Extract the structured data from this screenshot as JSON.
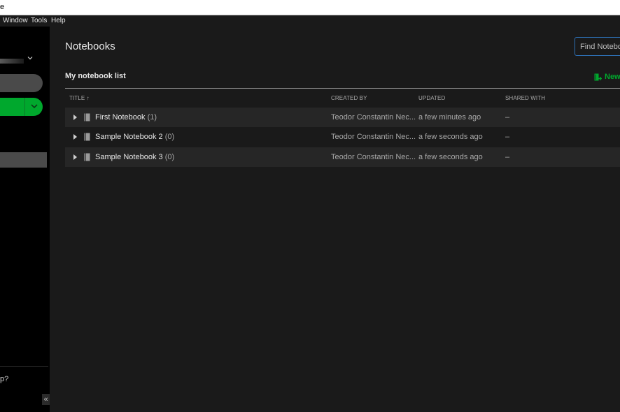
{
  "window": {
    "title_fragment": "e"
  },
  "menu": {
    "items": [
      "Window",
      "Tools",
      "Help"
    ]
  },
  "sidebar": {
    "help_text_fragment": "p?",
    "collapse_glyph": "«"
  },
  "main": {
    "page_title": "Notebooks",
    "search_placeholder": "Find Notebooks",
    "list_title": "My notebook list",
    "new_notebook_label": "New",
    "columns": {
      "title": "TITLE",
      "title_sort_arrow": "↑",
      "created_by": "CREATED BY",
      "updated": "UPDATED",
      "shared_with": "SHARED WITH"
    },
    "notebooks": [
      {
        "name": "First Notebook",
        "count": "(1)",
        "created_by": "Teodor Constantin Nec...",
        "updated": "a few minutes ago",
        "shared_with": "–"
      },
      {
        "name": "Sample Notebook 2",
        "count": "(0)",
        "created_by": "Teodor Constantin Nec...",
        "updated": "a few seconds ago",
        "shared_with": "–"
      },
      {
        "name": "Sample Notebook 3",
        "count": "(0)",
        "created_by": "Teodor Constantin Nec...",
        "updated": "a few seconds ago",
        "shared_with": "–"
      }
    ]
  },
  "colors": {
    "accent_green": "#00a82d",
    "focus_blue": "#2d6fb3",
    "background": "#1a1a1a",
    "sidebar": "#000000"
  },
  "icons": {
    "notebook": "notebook-icon",
    "expand": "expand-caret-icon",
    "account_dropdown": "chevron-down-icon",
    "new_dropdown": "chevron-down-icon",
    "new_notebook": "new-notebook-icon",
    "collapse": "collapse-sidebar-icon"
  }
}
